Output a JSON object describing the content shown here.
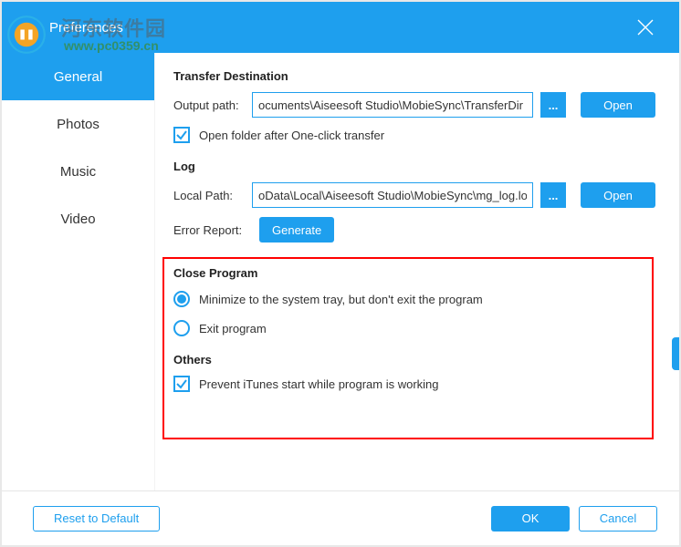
{
  "titlebar": {
    "title": "Preferences"
  },
  "watermark": {
    "line1": "河东软件园",
    "line2": "www.pc0359.cn"
  },
  "sidebar": {
    "tabs": [
      {
        "label": "General"
      },
      {
        "label": "Photos"
      },
      {
        "label": "Music"
      },
      {
        "label": "Video"
      }
    ],
    "active_index": 0
  },
  "sections": {
    "transfer": {
      "heading": "Transfer Destination",
      "output_label": "Output path:",
      "output_value": "ocuments\\Aiseesoft Studio\\MobieSync\\TransferDir",
      "browse_icon": "...",
      "open_btn": "Open",
      "open_folder_chk": "Open folder after One-click transfer",
      "open_folder_checked": true
    },
    "log": {
      "heading": "Log",
      "local_label": "Local Path:",
      "local_value": "oData\\Local\\Aiseesoft Studio\\MobieSync\\mg_log.log",
      "browse_icon": "...",
      "open_btn": "Open",
      "error_report_label": "Error Report:",
      "generate_btn": "Generate"
    },
    "close_program": {
      "heading": "Close Program",
      "opt_minimize": "Minimize to the system tray, but don't exit the program",
      "opt_exit": "Exit program",
      "selected": "minimize"
    },
    "others": {
      "heading": "Others",
      "prevent_itunes": "Prevent iTunes start while program is working",
      "prevent_itunes_checked": true
    }
  },
  "footer": {
    "reset": "Reset to Default",
    "ok": "OK",
    "cancel": "Cancel"
  }
}
